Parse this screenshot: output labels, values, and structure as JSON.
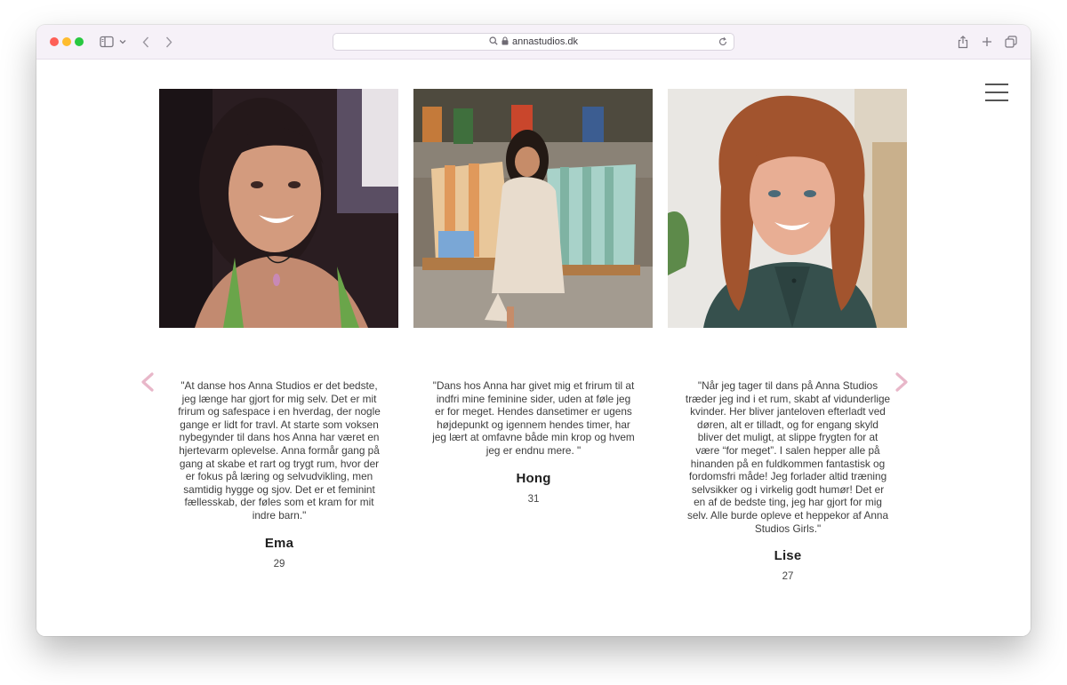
{
  "browser": {
    "url": "annastudios.dk"
  },
  "nav": {
    "menu_icon": "hamburger-menu-icon"
  },
  "carousel": {
    "prev_icon": "chevron-left-icon",
    "next_icon": "chevron-right-icon",
    "arrow_color": "#e8b7c9"
  },
  "testimonials": [
    {
      "quote": "\"At danse hos Anna Studios er det bedste, jeg længe har gjort for mig selv. Det er mit frirum og safespace i en hverdag, der nogle gange er lidt for travl. At starte som voksen nybegynder til dans hos Anna har været en hjertevarm oplevelse. Anna formår gang på gang at skabe et rart og trygt rum, hvor der er fokus på læring og selvudvikling, men samtidig hygge og sjov. Det er et feminint fællesskab, der føles som et kram for mit indre barn.\"",
      "name": "Ema",
      "age": "29"
    },
    {
      "quote": "\"Dans hos Anna har givet mig et frirum til at indfri mine feminine sider, uden at føle jeg er for meget. Hendes dansetimer er ugens højdepunkt og igennem hendes timer, har jeg lært at omfavne både min krop og hvem jeg er endnu mere. \"",
      "name": "Hong",
      "age": "31"
    },
    {
      "quote": "\"Når jeg tager til dans på Anna Studios træder jeg ind i et rum, skabt af vidunderlige kvinder. Her bliver janteloven efterladt ved døren, alt er tilladt, og for engang skyld bliver det muligt, at slippe frygten for at være “for meget”. I salen hepper alle på hinanden på en fuldkommen fantastisk og fordomsfri måde! Jeg forlader altid træning selvsikker og i virkelig godt humør! Det er en af de bedste ting, jeg har gjort for mig selv. Alle burde opleve et heppekor af Anna Studios Girls.\"",
      "name": "Lise",
      "age": "27"
    }
  ]
}
